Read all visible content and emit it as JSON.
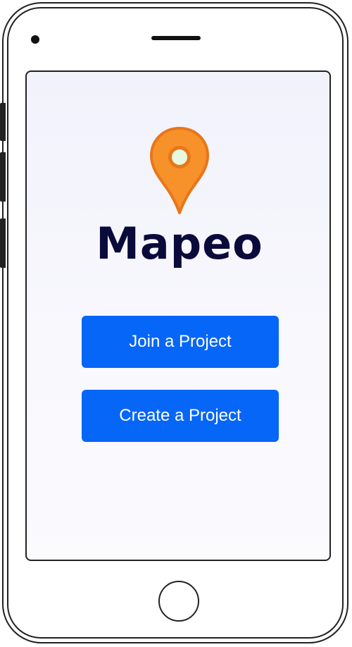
{
  "app": {
    "title": "Mapeo",
    "logo_icon": "map-pin-icon"
  },
  "actions": {
    "join_label": "Join a Project",
    "create_label": "Create a Project"
  },
  "colors": {
    "brand_blue": "#0666f7",
    "pin_orange": "#f7922a",
    "pin_dot": "#e6f8de",
    "title_navy": "#0a0a3b"
  }
}
